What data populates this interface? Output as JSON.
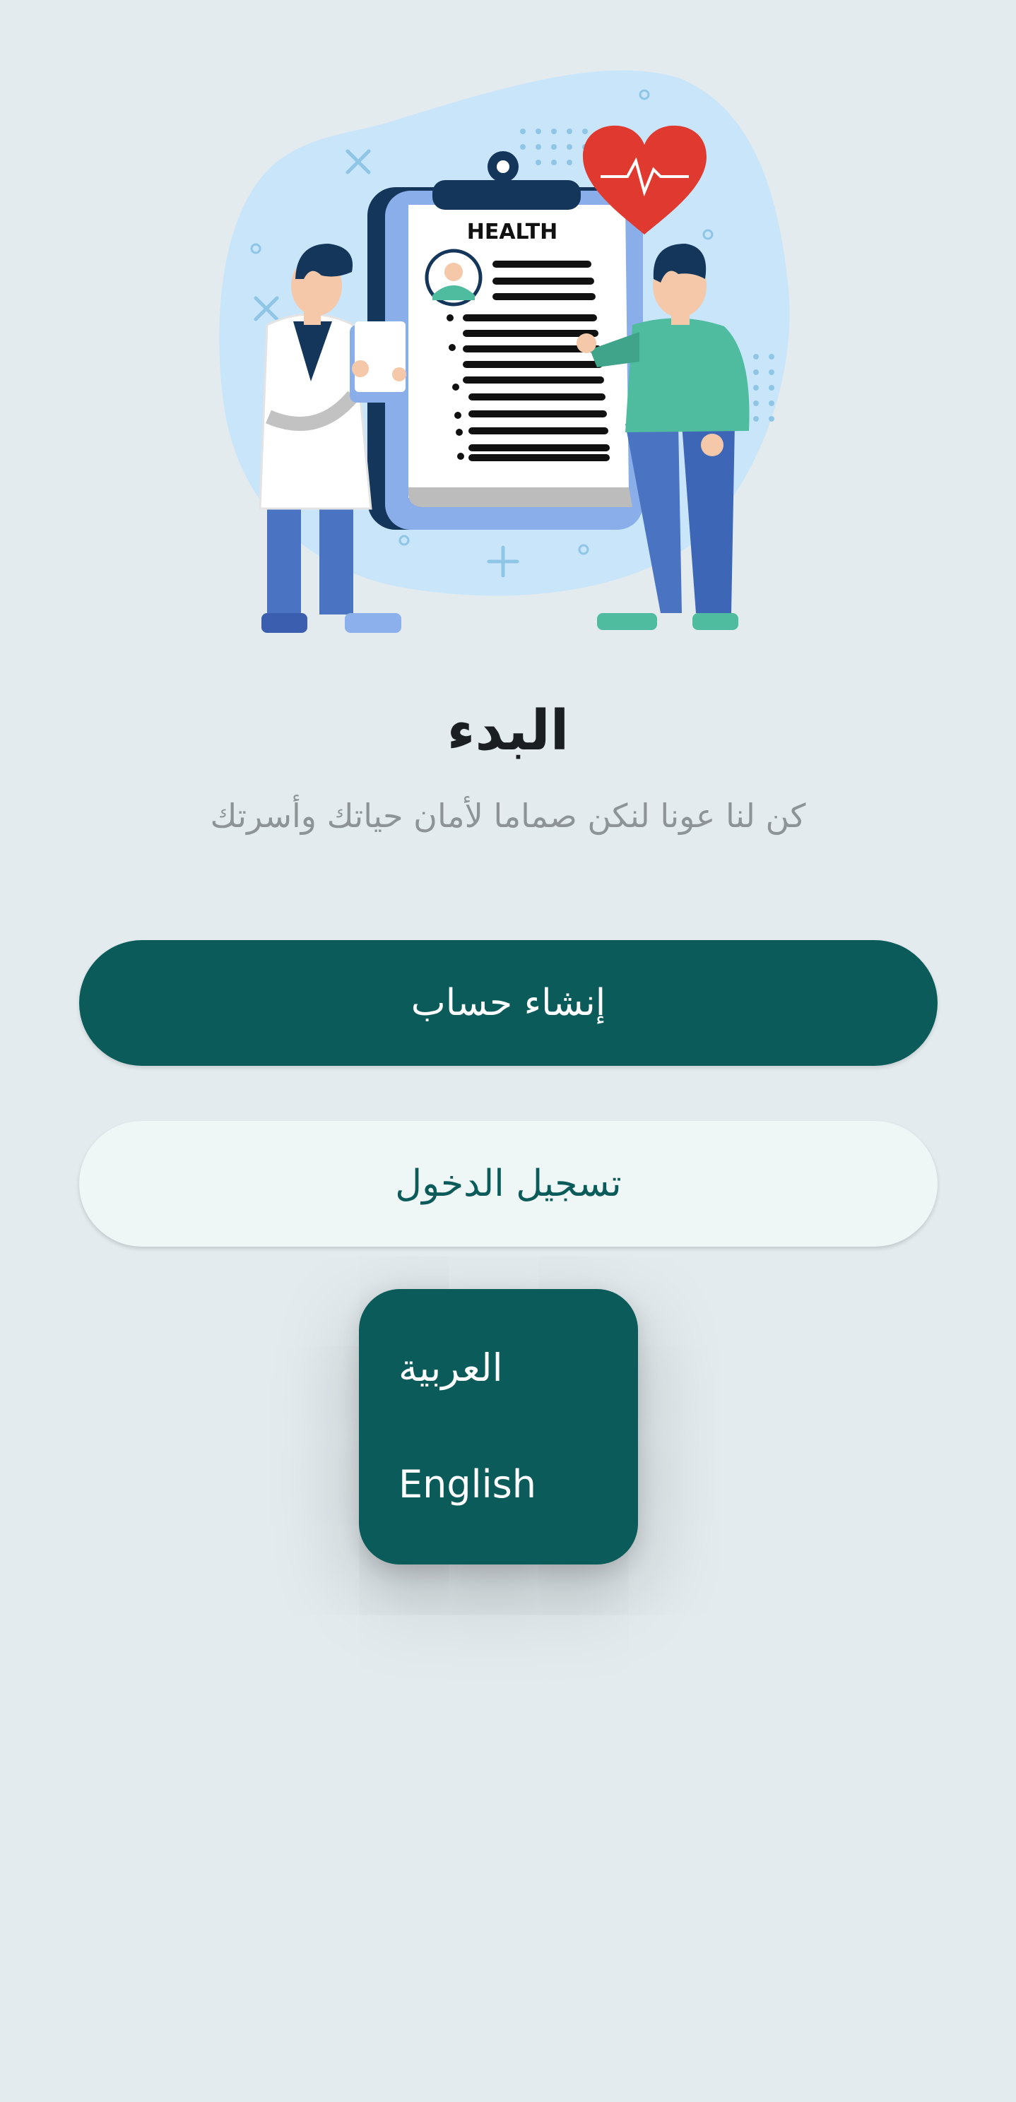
{
  "illustration": {
    "clipboard_title": "HEALTH"
  },
  "onboarding": {
    "title": "البدء",
    "subtitle": "كن لنا عونا لنكن صماما لأمان حياتك وأسرتك"
  },
  "buttons": {
    "create_account": "إنشاء حساب",
    "login": "تسجيل الدخول"
  },
  "language_menu": {
    "options": [
      "العربية",
      "English"
    ]
  },
  "colors": {
    "primary": "#0b5b5b",
    "background": "#e3ebee",
    "secondary_button": "#eff6f6",
    "heart": "#e0392f",
    "blob": "#cfe7fa"
  }
}
